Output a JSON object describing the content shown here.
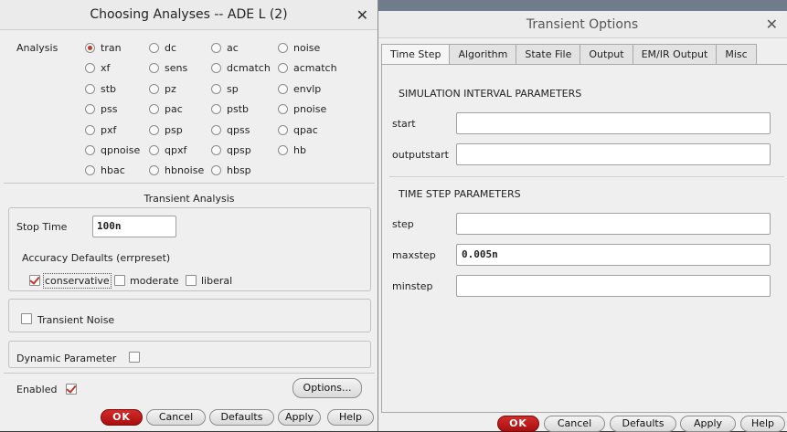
{
  "choosing_analyses": {
    "title": "Choosing Analyses -- ADE L (2)",
    "analysis_label": "Analysis",
    "analyses": [
      {
        "name": "tran",
        "selected": true
      },
      {
        "name": "dc",
        "selected": false
      },
      {
        "name": "ac",
        "selected": false
      },
      {
        "name": "noise",
        "selected": false
      },
      {
        "name": "xf",
        "selected": false
      },
      {
        "name": "sens",
        "selected": false
      },
      {
        "name": "dcmatch",
        "selected": false
      },
      {
        "name": "acmatch",
        "selected": false
      },
      {
        "name": "stb",
        "selected": false
      },
      {
        "name": "pz",
        "selected": false
      },
      {
        "name": "sp",
        "selected": false
      },
      {
        "name": "envlp",
        "selected": false
      },
      {
        "name": "pss",
        "selected": false
      },
      {
        "name": "pac",
        "selected": false
      },
      {
        "name": "pstb",
        "selected": false
      },
      {
        "name": "pnoise",
        "selected": false
      },
      {
        "name": "pxf",
        "selected": false
      },
      {
        "name": "psp",
        "selected": false
      },
      {
        "name": "qpss",
        "selected": false
      },
      {
        "name": "qpac",
        "selected": false
      },
      {
        "name": "qpnoise",
        "selected": false
      },
      {
        "name": "qpxf",
        "selected": false
      },
      {
        "name": "qpsp",
        "selected": false
      },
      {
        "name": "hb",
        "selected": false
      },
      {
        "name": "hbac",
        "selected": false
      },
      {
        "name": "hbnoise",
        "selected": false
      },
      {
        "name": "hbsp",
        "selected": false
      }
    ],
    "section_title": "Transient Analysis",
    "stop_time_label": "Stop Time",
    "stop_time_value": "100n",
    "accuracy_label": "Accuracy Defaults (errpreset)",
    "accuracy_options": [
      {
        "label": "conservative",
        "checked": true
      },
      {
        "label": "moderate",
        "checked": false
      },
      {
        "label": "liberal",
        "checked": false
      }
    ],
    "transient_noise_label": "Transient Noise",
    "transient_noise_checked": false,
    "dynamic_parameter_label": "Dynamic Parameter",
    "dynamic_parameter_checked": false,
    "enabled_label": "Enabled",
    "enabled_checked": true,
    "options_button": "Options...",
    "buttons": {
      "ok": "OK",
      "cancel": "Cancel",
      "defaults": "Defaults",
      "apply": "Apply",
      "help": "Help"
    }
  },
  "transient_options": {
    "title": "Transient Options",
    "tabs": [
      "Time Step",
      "Algorithm",
      "State File",
      "Output",
      "EM/IR Output",
      "Misc"
    ],
    "active_tab": "Time Step",
    "interval_section": "SIMULATION INTERVAL PARAMETERS",
    "interval_fields": [
      {
        "label": "start",
        "value": ""
      },
      {
        "label": "outputstart",
        "value": ""
      }
    ],
    "timestep_section": "TIME STEP PARAMETERS",
    "timestep_fields": [
      {
        "label": "step",
        "value": ""
      },
      {
        "label": "maxstep",
        "value": "0.005n"
      },
      {
        "label": "minstep",
        "value": ""
      }
    ],
    "buttons": {
      "ok": "OK",
      "cancel": "Cancel",
      "defaults": "Defaults",
      "apply": "Apply",
      "help": "Help"
    }
  },
  "colors": {
    "accent_red": "#c0392b",
    "ok_button": "#b81818"
  },
  "icons": {
    "close": "close-icon",
    "radio": "radio-icon",
    "checkbox": "checkbox-icon"
  }
}
